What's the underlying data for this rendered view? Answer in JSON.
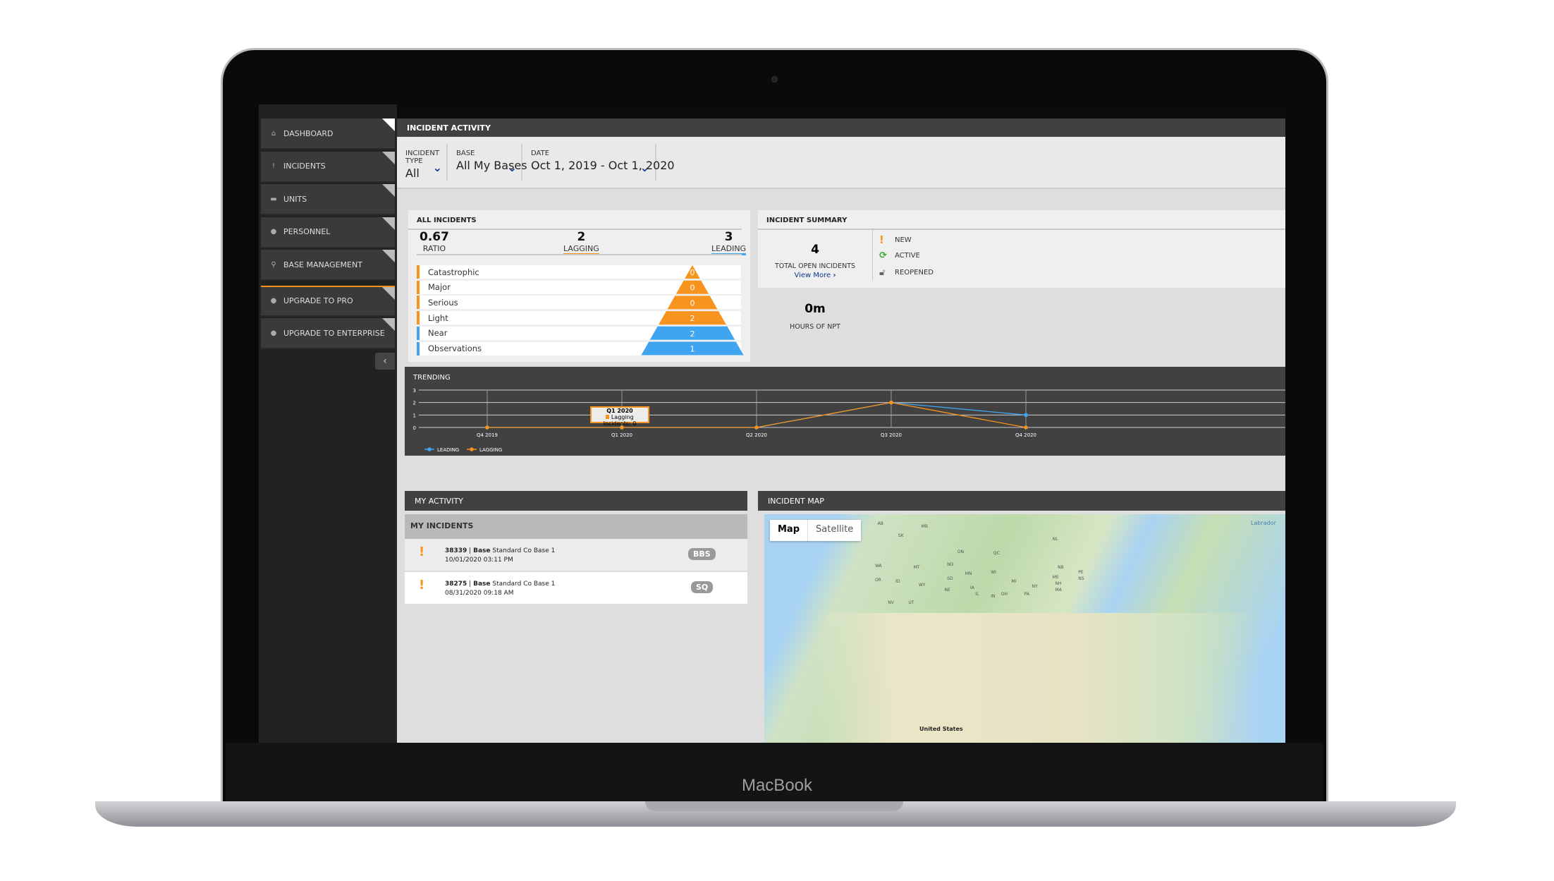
{
  "device": {
    "brand": "MacBook"
  },
  "sidebar": {
    "items": [
      {
        "label": "DASHBOARD",
        "icon": "home-icon",
        "active": true
      },
      {
        "label": "INCIDENTS",
        "icon": "exclamation-icon"
      },
      {
        "label": "UNITS",
        "icon": "truck-icon"
      },
      {
        "label": "PERSONNEL",
        "icon": "person-icon"
      },
      {
        "label": "BASE MANAGEMENT",
        "icon": "map-pin-icon"
      },
      {
        "label": "UPGRADE TO PRO",
        "icon": "badge-icon"
      },
      {
        "label": "UPGRADE TO ENTERPRISE",
        "icon": "badge-icon"
      }
    ],
    "collapse_icon": "chevron-left-icon"
  },
  "header": {
    "title": "INCIDENT ACTIVITY"
  },
  "filters": {
    "incident_type": {
      "label": "INCIDENT TYPE",
      "value": "All"
    },
    "base": {
      "label": "BASE",
      "value": "All My Bases"
    },
    "date": {
      "label": "DATE",
      "value": "Oct 1, 2019 - Oct 1, 2020"
    }
  },
  "all_incidents": {
    "title": "ALL INCIDENTS",
    "ratio": {
      "value": "0.67",
      "label": "RATIO"
    },
    "lagging": {
      "value": "2",
      "label": "LAGGING"
    },
    "leading": {
      "value": "3",
      "label": "LEADING"
    },
    "rows": [
      {
        "label": "Catastrophic",
        "value": "0",
        "type": "lagging"
      },
      {
        "label": "Major",
        "value": "0",
        "type": "lagging"
      },
      {
        "label": "Serious",
        "value": "0",
        "type": "lagging"
      },
      {
        "label": "Light",
        "value": "2",
        "type": "lagging"
      },
      {
        "label": "Near",
        "value": "2",
        "type": "leading"
      },
      {
        "label": "Observations",
        "value": "1",
        "type": "leading"
      }
    ],
    "colors": {
      "lagging": "#f7941d",
      "leading": "#3fa5f0"
    }
  },
  "summary": {
    "title": "INCIDENT SUMMARY",
    "total": "4",
    "total_label": "TOTAL OPEN INCIDENTS",
    "view_more": "View More",
    "statuses": [
      {
        "label": "NEW",
        "icon": "exclamation-icon"
      },
      {
        "label": "ACTIVE",
        "icon": "refresh-icon"
      },
      {
        "label": "REOPENED",
        "icon": "unlock-icon"
      }
    ],
    "npt_value": "0m",
    "npt_label": "HOURS OF NPT"
  },
  "trending": {
    "title": "TRENDING",
    "tooltip": {
      "title": "Q1 2020",
      "text": "Lagging Incidents: 0"
    }
  },
  "chart_data": {
    "type": "line",
    "categories": [
      "Q4 2019",
      "Q1 2020",
      "Q2 2020",
      "Q3 2020",
      "Q4 2020"
    ],
    "ylim": [
      0,
      3
    ],
    "yticks": [
      "0",
      "1",
      "2",
      "3"
    ],
    "grid": true,
    "legend": "bottom-left",
    "series": [
      {
        "name": "LEADING",
        "color": "#3fa5f0",
        "values": [
          0,
          0,
          0,
          2,
          1
        ]
      },
      {
        "name": "LAGGING",
        "color": "#f7941d",
        "values": [
          0,
          0,
          0,
          2,
          0
        ]
      }
    ]
  },
  "activity": {
    "title": "MY ACTIVITY",
    "subtitle": "MY INCIDENTS",
    "incidents": [
      {
        "id": "38339",
        "base_label": "Base",
        "base": "Standard Co Base 1",
        "date": "10/01/2020 03:11 PM",
        "badge": "BBS"
      },
      {
        "id": "38275",
        "base_label": "Base",
        "base": "Standard Co Base 1",
        "date": "08/31/2020 09:18 AM",
        "badge": "SQ"
      }
    ]
  },
  "map": {
    "title": "INCIDENT MAP",
    "map_btn": "Map",
    "satellite_btn": "Satellite",
    "labels": [
      "AB",
      "MB",
      "SK",
      "ON",
      "QC",
      "NL",
      "Labrador",
      "WA",
      "MT",
      "ND",
      "MN",
      "OR",
      "ID",
      "WY",
      "SD",
      "WI",
      "MI",
      "NY",
      "NB",
      "PE",
      "NS",
      "ME",
      "NH",
      "MA",
      "NE",
      "IA",
      "IL",
      "IN",
      "OH",
      "PA",
      "NV",
      "UT",
      "United States"
    ]
  }
}
